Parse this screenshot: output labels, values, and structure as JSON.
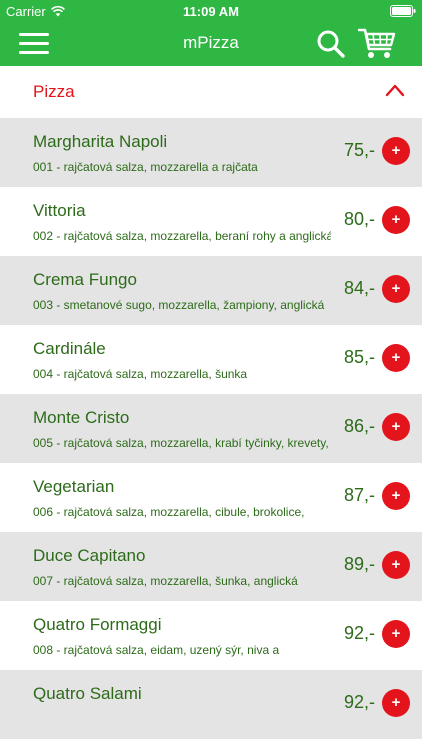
{
  "status_bar": {
    "carrier": "Carrier",
    "time": "11:09 AM"
  },
  "nav": {
    "title": "mPizza",
    "menu_icon": "hamburger-menu-icon",
    "search_icon": "search-icon",
    "cart_icon": "shopping-cart-icon"
  },
  "colors": {
    "brand_green": "#2fb744",
    "text_green": "#2d6b1a",
    "accent_red": "#e3141b",
    "row_gray": "#e4e4e4"
  },
  "category": {
    "title": "Pizza",
    "expanded_icon": "chevron-up-icon"
  },
  "items": [
    {
      "name": "Margharita Napoli",
      "desc": "001 - rajčatová salza, mozzarella a rajčata",
      "price": "75,-",
      "add": "+"
    },
    {
      "name": "Vittoria",
      "desc": "002 - rajčatová salza, mozzarella, beraní rohy a anglická",
      "price": "80,-",
      "add": "+"
    },
    {
      "name": "Crema Fungo",
      "desc": "003 - smetanové sugo, mozzarella, žampiony, anglická",
      "price": "84,-",
      "add": "+"
    },
    {
      "name": "Cardinále",
      "desc": "004 - rajčatová salza, mozzarella, šunka",
      "price": "85,-",
      "add": "+"
    },
    {
      "name": "Monte Cristo",
      "desc": "005 - rajčatová salza, mozzarella, krabí tyčinky, krevety,",
      "price": "86,-",
      "add": "+"
    },
    {
      "name": "Vegetarian",
      "desc": "006 - rajčatová salza, mozzarella, cibule, brokolice,",
      "price": "87,-",
      "add": "+"
    },
    {
      "name": "Duce Capitano",
      "desc": "007 - rajčatová salza, mozzarella, šunka, anglická",
      "price": "89,-",
      "add": "+"
    },
    {
      "name": "Quatro Formaggi",
      "desc": "008 - rajčatová salza, eidam, uzený sýr, niva a",
      "price": "92,-",
      "add": "+"
    },
    {
      "name": "Quatro Salami",
      "desc": "",
      "price": "92,-",
      "add": "+"
    }
  ]
}
